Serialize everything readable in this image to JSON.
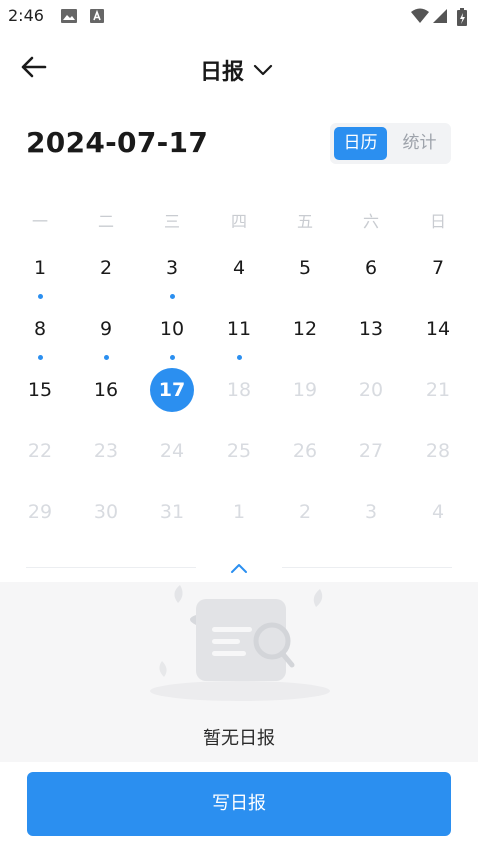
{
  "status_bar": {
    "time": "2:46",
    "icons": [
      "image-icon",
      "app-a-icon",
      "wifi-icon",
      "cell-signal-icon",
      "battery-charging-icon"
    ]
  },
  "header": {
    "title": "日报",
    "back_icon": "arrow-left-icon",
    "dropdown_icon": "chevron-down-icon"
  },
  "date_label": "2024-07-17",
  "view_toggle": {
    "active": "日历",
    "inactive": "统计"
  },
  "calendar": {
    "weekdays": [
      "一",
      "二",
      "三",
      "四",
      "五",
      "六",
      "日"
    ],
    "rows": [
      [
        {
          "d": "1",
          "dot": true
        },
        {
          "d": "2"
        },
        {
          "d": "3",
          "dot": true
        },
        {
          "d": "4"
        },
        {
          "d": "5"
        },
        {
          "d": "6"
        },
        {
          "d": "7"
        }
      ],
      [
        {
          "d": "8",
          "dot": true
        },
        {
          "d": "9",
          "dot": true
        },
        {
          "d": "10",
          "dot": true
        },
        {
          "d": "11",
          "dot": true
        },
        {
          "d": "12"
        },
        {
          "d": "13"
        },
        {
          "d": "14"
        }
      ],
      [
        {
          "d": "15"
        },
        {
          "d": "16"
        },
        {
          "d": "17",
          "selected": true
        },
        {
          "d": "18",
          "faded": true
        },
        {
          "d": "19",
          "faded": true
        },
        {
          "d": "20",
          "faded": true
        },
        {
          "d": "21",
          "faded": true
        }
      ],
      [
        {
          "d": "22",
          "faded": true
        },
        {
          "d": "23",
          "faded": true
        },
        {
          "d": "24",
          "faded": true
        },
        {
          "d": "25",
          "faded": true
        },
        {
          "d": "26",
          "faded": true
        },
        {
          "d": "27",
          "faded": true
        },
        {
          "d": "28",
          "faded": true
        }
      ],
      [
        {
          "d": "29",
          "faded": true
        },
        {
          "d": "30",
          "faded": true
        },
        {
          "d": "31",
          "faded": true
        },
        {
          "d": "1",
          "faded": true
        },
        {
          "d": "2",
          "faded": true
        },
        {
          "d": "3",
          "faded": true
        },
        {
          "d": "4",
          "faded": true
        }
      ]
    ]
  },
  "empty_state": {
    "text": "暂无日报",
    "illustration": "empty-scroll-illustration"
  },
  "write_button": "写日报",
  "colors": {
    "accent": "#2b8ff0",
    "faded": "#d8dbe0",
    "panel": "#f6f6f7"
  }
}
